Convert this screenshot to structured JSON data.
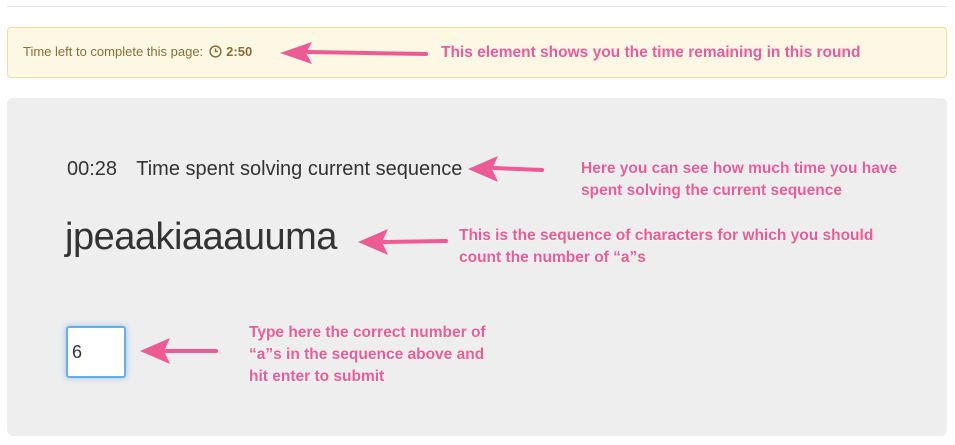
{
  "timer": {
    "label": "Time left to complete this page:",
    "value": "2:50"
  },
  "task": {
    "elapsed": "00:28",
    "elapsed_label": "Time spent solving current sequence",
    "sequence": "jpeaakiaaauuma",
    "answer_value": "6"
  },
  "annotations": {
    "timer": "This element shows you the time remaining in this round",
    "elapsed_line1": "Here you can see how much time you have",
    "elapsed_line2": "spent solving the current sequence",
    "sequence_line1": "This is the sequence of characters for which you should",
    "sequence_line2": "count the number of “a”s",
    "input_line1": "Type here the correct number of",
    "input_line2": "“a”s in the sequence above and",
    "input_line3": "hit enter to submit"
  },
  "colors": {
    "annotation": "#ee5a93",
    "timer_bg": "#fcf8e3",
    "timer_text": "#8a6d3b",
    "panel_bg": "#eeeeee",
    "input_focus": "#66afe9"
  },
  "icons": {
    "timer": "clock-icon",
    "pointer": "arrow-left-icon"
  }
}
